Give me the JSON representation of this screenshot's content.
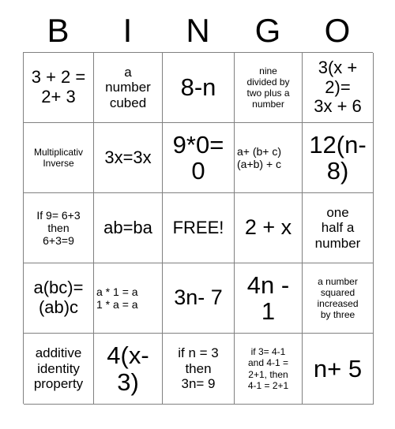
{
  "card": {
    "title": "BINGO",
    "header": {
      "letters": [
        "B",
        "I",
        "N",
        "G",
        "O"
      ]
    },
    "free_space_label": "FREE!",
    "grid": {
      "columns": 5,
      "rows": 5,
      "border_color": "#808080",
      "background_color": "#ffffff",
      "text_color": "#000000"
    },
    "cells": [
      [
        {
          "text": "3 + 2 =\n2+ 3",
          "size": "lg",
          "align": "center"
        },
        {
          "text": "a\nnumber\ncubed",
          "size": "md",
          "align": "center"
        },
        {
          "text": "8-n",
          "size": "xxl",
          "align": "center"
        },
        {
          "text": "nine\ndivided by\ntwo plus a\nnumber",
          "size": "xs",
          "align": "center"
        },
        {
          "text": "3(x +\n2)=\n3x + 6",
          "size": "lg",
          "align": "center"
        }
      ],
      [
        {
          "text": "Multiplicativ\nInverse",
          "size": "xs",
          "align": "center"
        },
        {
          "text": "3x=3x",
          "size": "lg",
          "align": "center"
        },
        {
          "text": "9*0=\n0",
          "size": "xxl",
          "align": "center"
        },
        {
          "text": "a+ (b+ c)\n(a+b) + c",
          "size": "sm",
          "align": "left"
        },
        {
          "text": "12(n-\n8)",
          "size": "xxl",
          "align": "center"
        }
      ],
      [
        {
          "text": "If 9= 6+3\nthen\n6+3=9",
          "size": "sm",
          "align": "center"
        },
        {
          "text": "ab=ba",
          "size": "lg",
          "align": "center"
        },
        {
          "text": "FREE!",
          "size": "lg",
          "align": "center"
        },
        {
          "text": "2 + x",
          "size": "xl",
          "align": "center"
        },
        {
          "text": "one\nhalf a\nnumber",
          "size": "md",
          "align": "center"
        }
      ],
      [
        {
          "text": "a(bc)=\n(ab)c",
          "size": "lg",
          "align": "center"
        },
        {
          "text": "a * 1 = a\n1 * a = a",
          "size": "sm",
          "align": "left"
        },
        {
          "text": "3n- 7",
          "size": "xl",
          "align": "center"
        },
        {
          "text": "4n -\n1",
          "size": "xxl",
          "align": "center"
        },
        {
          "text": "a number\nsquared\nincreased\nby three",
          "size": "xs",
          "align": "center"
        }
      ],
      [
        {
          "text": "additive\nidentity\nproperty",
          "size": "md",
          "align": "center"
        },
        {
          "text": "4(x-\n3)",
          "size": "xxl",
          "align": "center"
        },
        {
          "text": "if n = 3\nthen\n3n= 9",
          "size": "md",
          "align": "center"
        },
        {
          "text": "if 3= 4-1\nand 4-1 =\n2+1, then\n4-1 = 2+1",
          "size": "xs",
          "align": "center"
        },
        {
          "text": "n+ 5",
          "size": "xxl",
          "align": "center"
        }
      ]
    ]
  }
}
